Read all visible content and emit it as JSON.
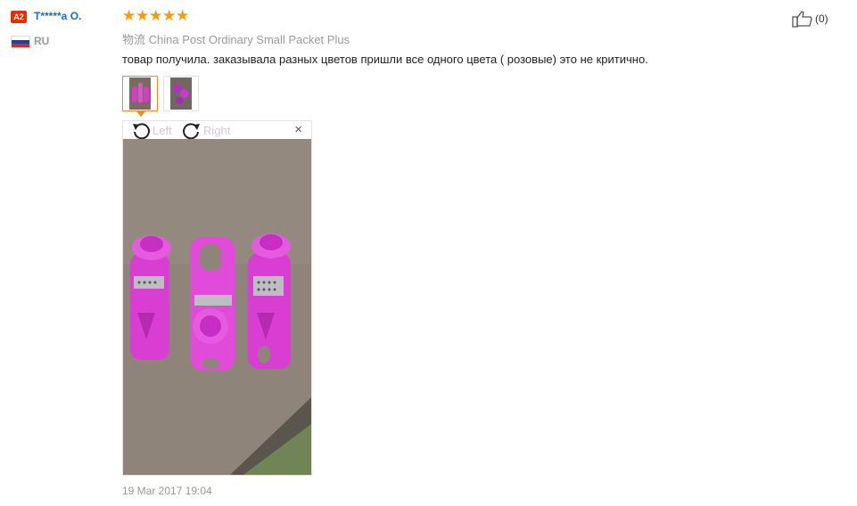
{
  "reviewer": {
    "level_badge": "A2",
    "name": "T*****a O.",
    "country": "RU"
  },
  "rating": {
    "stars": 5,
    "max": 5
  },
  "shipping": {
    "label": "物流",
    "method": "China Post Ordinary Small Packet Plus"
  },
  "review_text": "товар получила. заказывала разных цветов пришли все одного цвета ( розовые) это не критично.",
  "thumbnails": [
    "photo-1",
    "photo-2"
  ],
  "viewer": {
    "rotate_left_label": "Left",
    "rotate_right_label": "Right",
    "close_label": "×"
  },
  "date": "19 Mar 2017 19:04",
  "helpful": {
    "count_label": "(0)"
  },
  "colors": {
    "badge": "#e62e04",
    "username": "#1a6fb8",
    "star": "#ff9a00",
    "thumb_active_border": "#f08a24"
  }
}
